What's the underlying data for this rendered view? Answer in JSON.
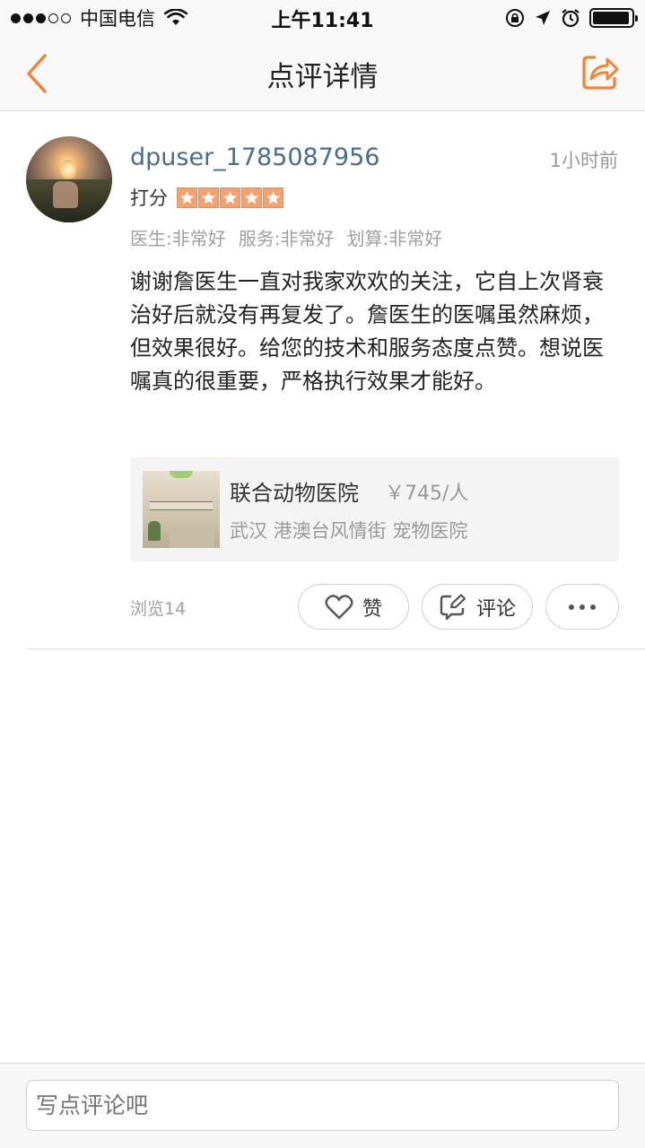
{
  "status_bar": {
    "carrier": "中国电信",
    "time": "上午11:41",
    "battery_level": 0.95
  },
  "nav": {
    "title": "点评详情",
    "icons": {
      "back": "chevron-left-icon",
      "share": "share-icon"
    }
  },
  "review": {
    "username": "dpuser_1785087956",
    "time_ago": "1小时前",
    "score_label": "打分",
    "stars": 5,
    "sub_scores": [
      "医生:非常好",
      "服务:非常好",
      "划算:非常好"
    ],
    "text": "谢谢詹医生一直对我家欢欢的关注，它自上次肾衰治好后就没有再复发了。詹医生的医嘱虽然麻烦，但效果很好。给您的技术和服务态度点赞。想说医嘱真的很重要，严格执行效果才能好。"
  },
  "shop": {
    "name": "联合动物医院",
    "price": "￥745/人",
    "location": "武汉 港澳台风情街 宠物医院"
  },
  "actions": {
    "views": "浏览14",
    "like_label": "赞",
    "comment_label": "评论"
  },
  "comment_bar": {
    "placeholder": "写点评论吧"
  },
  "colors": {
    "accent": "#f0843a",
    "username": "#4a6d8f",
    "star_bg": "#f6a16e"
  }
}
